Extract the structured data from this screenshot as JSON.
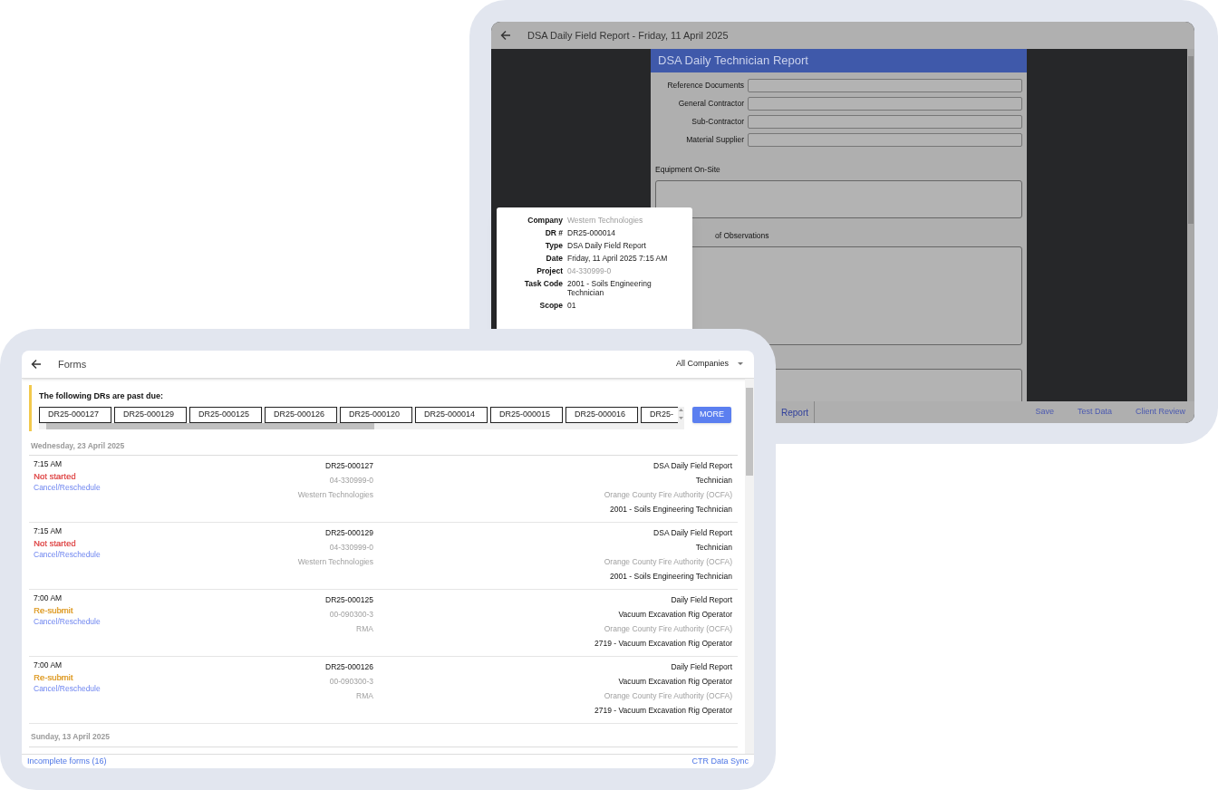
{
  "report_window": {
    "title": "DSA Daily Field Report - Friday, 11 April 2025",
    "form": {
      "header": "DSA Daily Technician Report",
      "fields": [
        {
          "label": "Reference Documents"
        },
        {
          "label": "General Contractor"
        },
        {
          "label": "Sub-Contractor"
        },
        {
          "label": "Material Supplier"
        }
      ],
      "sections": [
        {
          "label": "Equipment On-Site",
          "kind": "short"
        },
        {
          "label": "of Observations",
          "kind": "tall"
        },
        {
          "kind": "cut"
        }
      ]
    },
    "details": [
      {
        "label": "Company",
        "value": "Western Technologies",
        "redacted": true
      },
      {
        "label": "DR #",
        "value": "DR25-000014",
        "redacted": false
      },
      {
        "label": "Type",
        "value": "DSA Daily Field Report",
        "redacted": false
      },
      {
        "label": "Date",
        "value": "Friday, 11 April 2025 7:15 AM",
        "redacted": false
      },
      {
        "label": "Project",
        "value": "04-330999-0",
        "redacted": true
      },
      {
        "label": "Task Code",
        "value": "2001 - Soils Engineering Technician",
        "redacted": false
      },
      {
        "label": "Scope",
        "value": "01",
        "redacted": false
      }
    ],
    "footer": {
      "tab": "Report",
      "actions": [
        "Save",
        "Test Data",
        "Client Review"
      ]
    }
  },
  "forms_window": {
    "title": "Forms",
    "company_filter": "All Companies",
    "past_due": {
      "title": "The following DRs are past due:",
      "items": [
        "DR25-000127",
        "DR25-000129",
        "DR25-000125",
        "DR25-000126",
        "DR25-000120",
        "DR25-000014",
        "DR25-000015",
        "DR25-000016",
        "DR25-"
      ],
      "more": "MORE"
    },
    "groups": [
      {
        "date": "Wednesday, 23 April 2025",
        "entries": [
          {
            "time": "7:15 AM",
            "status": "Not started",
            "color": "#e05050",
            "action": "Cancel/Reschedule",
            "dr": "DR25-000127",
            "project": "04-330999-0",
            "company": "Western Technologies",
            "type": "DSA Daily Field Report",
            "role": "Technician",
            "client": "Orange County Fire Authority (OCFA)",
            "task": "2001 - Soils Engineering Technician"
          },
          {
            "time": "7:15 AM",
            "status": "Not started",
            "color": "#e05050",
            "action": "Cancel/Reschedule",
            "dr": "DR25-000129",
            "project": "04-330999-0",
            "company": "Western Technologies",
            "type": "DSA Daily Field Report",
            "role": "Technician",
            "client": "Orange County Fire Authority (OCFA)",
            "task": "2001 - Soils Engineering Technician"
          },
          {
            "time": "7:00 AM",
            "status": "Re-submit",
            "color": "#e0a030",
            "action": "Cancel/Reschedule",
            "dr": "DR25-000125",
            "project": "00-090300-3",
            "company": "RMA",
            "type": "Daily Field Report",
            "role": "Vacuum Excavation Rig Operator",
            "client": "Orange County Fire Authority (OCFA)",
            "task": "2719 - Vacuum Excavation Rig Operator"
          },
          {
            "time": "7:00 AM",
            "status": "Re-submit",
            "color": "#e0a030",
            "action": "Cancel/Reschedule",
            "dr": "DR25-000126",
            "project": "00-090300-3",
            "company": "RMA",
            "type": "Daily Field Report",
            "role": "Vacuum Excavation Rig Operator",
            "client": "Orange County Fire Authority (OCFA)",
            "task": "2719 - Vacuum Excavation Rig Operator"
          }
        ]
      },
      {
        "date": "Sunday, 13 April 2025"
      }
    ],
    "footer": {
      "left": "Incomplete forms (16)",
      "right": "CTR Data Sync"
    }
  }
}
